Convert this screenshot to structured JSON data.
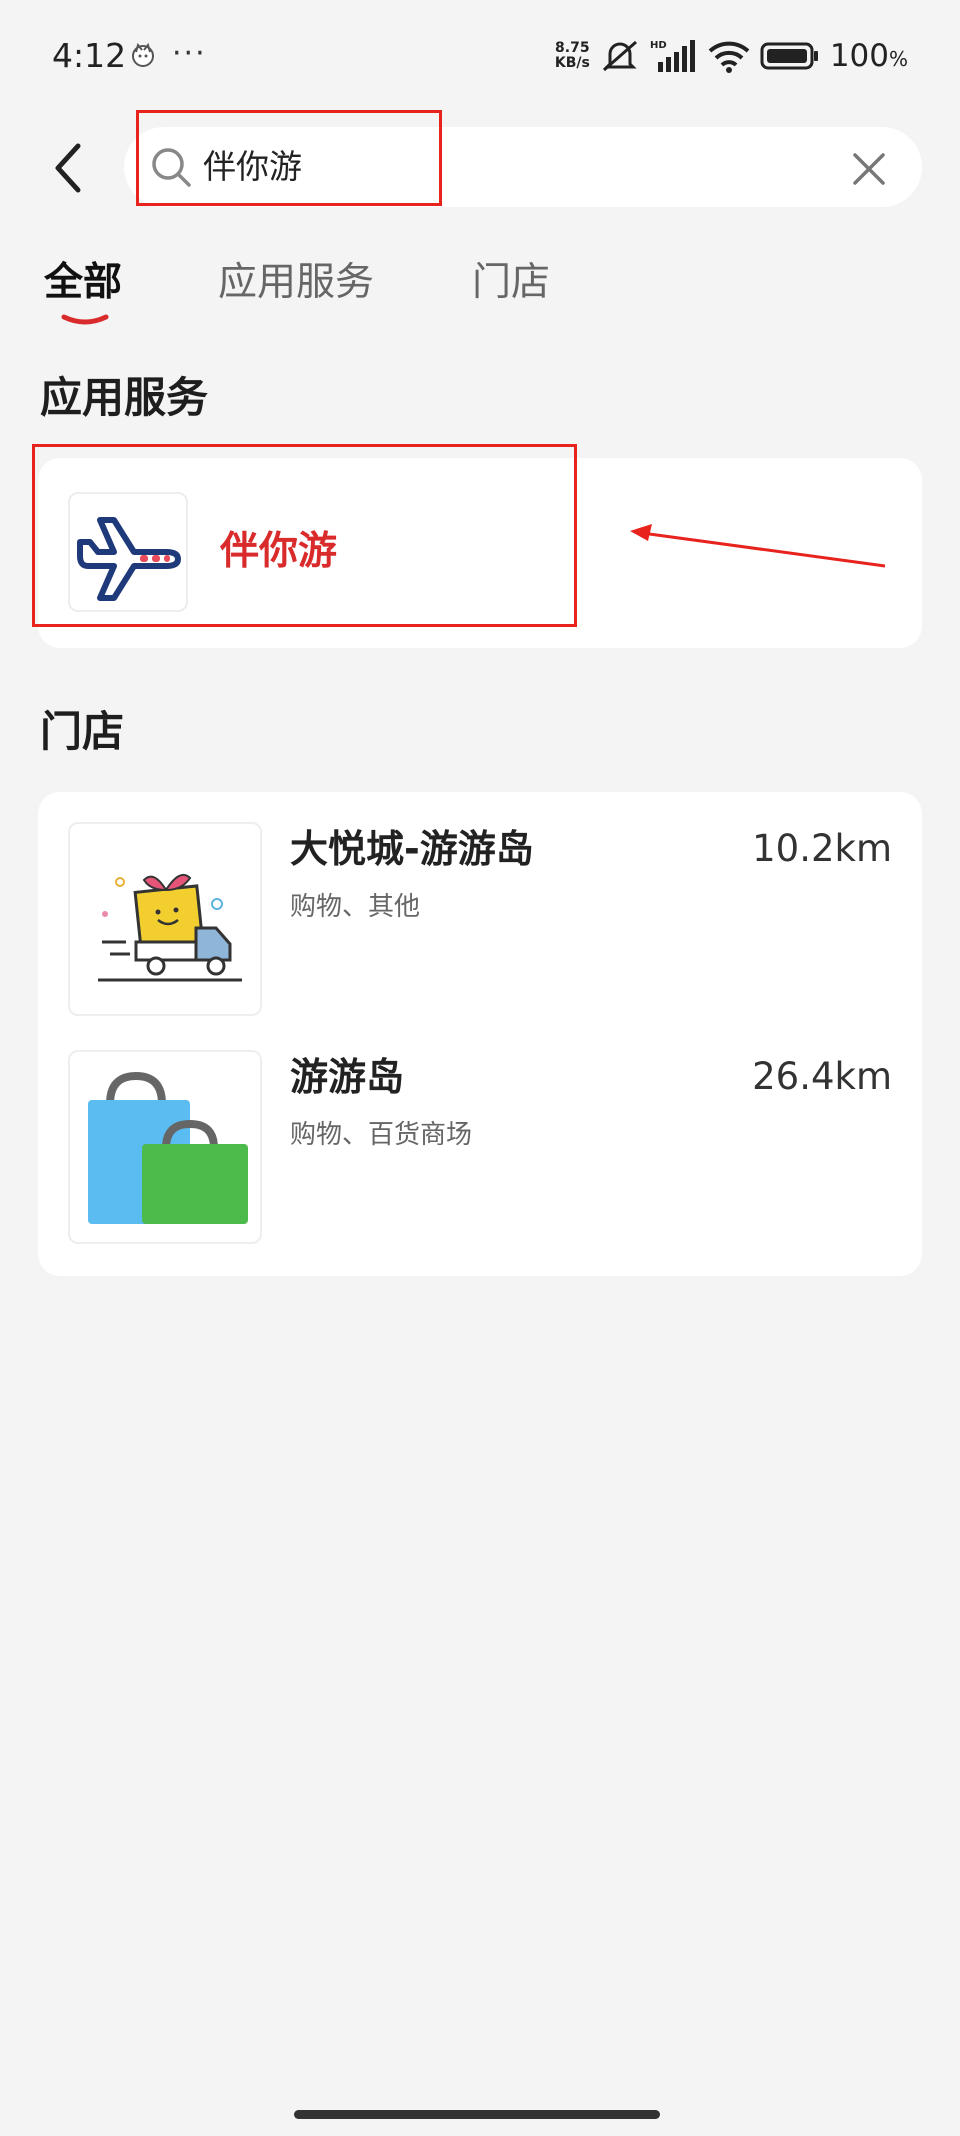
{
  "status_bar": {
    "time": "4:12",
    "dots": "···",
    "net_speed_value": "8.75",
    "net_speed_unit": "KB/s",
    "battery_pct": "100",
    "battery_unit": "%"
  },
  "search": {
    "value": "伴你游"
  },
  "tabs": [
    {
      "label": "全部"
    },
    {
      "label": "应用服务"
    },
    {
      "label": "门店"
    }
  ],
  "active_tab_index": 0,
  "sections": {
    "apps_title": "应用服务",
    "stores_title": "门店"
  },
  "app_result": {
    "name": "伴你游",
    "icon": "airplane-icon"
  },
  "stores": [
    {
      "name": "大悦城-游游岛",
      "category": "购物、其他",
      "distance": "10.2km",
      "icon": "gift-truck-icon"
    },
    {
      "name": "游游岛",
      "category": "购物、百货商场",
      "distance": "26.4km",
      "icon": "shopping-bags-icon"
    }
  ],
  "colors": {
    "accent": "#d92b2b",
    "annotation": "#e8231d",
    "background": "#f4f4f4"
  }
}
